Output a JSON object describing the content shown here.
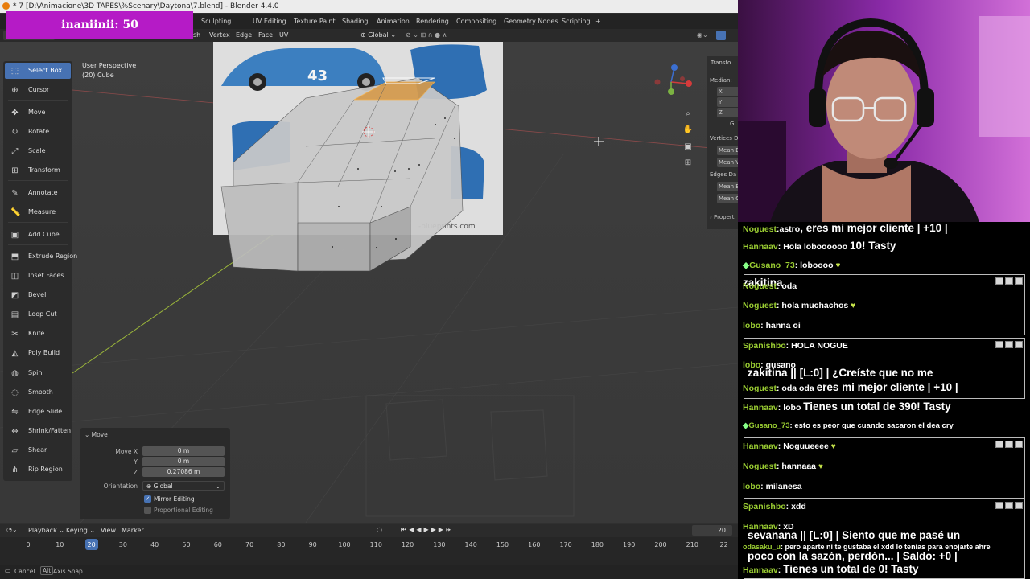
{
  "banner": {
    "text": "inaniinii: 50"
  },
  "window": {
    "title": "* 7 [D:\\Animacione\\3D TAPES\\%Scenary\\Daytona\\7.blend] - Blender 4.4.0"
  },
  "workspaces": [
    "Sculpting",
    "UV Editing",
    "Texture Paint",
    "Shading",
    "Animation",
    "Rendering",
    "Compositing",
    "Geometry Nodes",
    "Scripting",
    "+"
  ],
  "view_header": {
    "menus_left": [
      "sh",
      "Vertex",
      "Edge",
      "Face",
      "UV"
    ],
    "orientation": "Global"
  },
  "viewport": {
    "perspective": "User Perspective",
    "object": "(20) Cube",
    "blueprint_text": "-blueprints.com",
    "car_number": "43"
  },
  "tools": [
    {
      "label": "Select Box",
      "icon": "select-box-icon",
      "active": true
    },
    {
      "label": "Cursor",
      "icon": "cursor-icon"
    },
    {
      "label": "Move",
      "icon": "move-icon"
    },
    {
      "label": "Rotate",
      "icon": "rotate-icon"
    },
    {
      "label": "Scale",
      "icon": "scale-icon"
    },
    {
      "label": "Transform",
      "icon": "transform-icon"
    },
    {
      "label": "Annotate",
      "icon": "annotate-icon"
    },
    {
      "label": "Measure",
      "icon": "measure-icon"
    },
    {
      "label": "Add Cube",
      "icon": "add-cube-icon"
    },
    {
      "label": "Extrude Region",
      "icon": "extrude-icon"
    },
    {
      "label": "Inset Faces",
      "icon": "inset-icon"
    },
    {
      "label": "Bevel",
      "icon": "bevel-icon"
    },
    {
      "label": "Loop Cut",
      "icon": "loop-cut-icon"
    },
    {
      "label": "Knife",
      "icon": "knife-icon"
    },
    {
      "label": "Poly Build",
      "icon": "poly-build-icon"
    },
    {
      "label": "Spin",
      "icon": "spin-icon"
    },
    {
      "label": "Smooth",
      "icon": "smooth-icon"
    },
    {
      "label": "Edge Slide",
      "icon": "edge-slide-icon"
    },
    {
      "label": "Shrink/Fatten",
      "icon": "shrink-icon"
    },
    {
      "label": "Shear",
      "icon": "shear-icon"
    },
    {
      "label": "Rip Region",
      "icon": "rip-icon"
    }
  ],
  "npanel": {
    "tab": "Transfo",
    "median": "Median:",
    "x": "X",
    "y": "Y",
    "z": "Z",
    "gl": "Gl",
    "vertices": "Vertices D",
    "mean_b": "Mean B",
    "mean_v": "Mean V",
    "edges": "Edges Da",
    "mean_b2": "Mean B",
    "mean_c": "Mean C",
    "props": "Propert"
  },
  "operator": {
    "title": "Move",
    "move_x_label": "Move X",
    "move_x": "0 m",
    "y_label": "Y",
    "y": "0 m",
    "z_label": "Z",
    "z": "0.27086 m",
    "orientation_label": "Orientation",
    "orientation": "Global",
    "mirror": "Mirror Editing",
    "proportional": "Proportional Editing"
  },
  "timeline": {
    "menus": [
      "Playback",
      "Keying",
      "View",
      "Marker"
    ],
    "current_frame": "20",
    "ticks": [
      "0",
      "10",
      "20",
      "30",
      "40",
      "50",
      "60",
      "70",
      "80",
      "90",
      "100",
      "110",
      "120",
      "130",
      "140",
      "150",
      "160",
      "170",
      "180",
      "190",
      "200",
      "210",
      "22"
    ]
  },
  "status": {
    "cancel": "Cancel",
    "alt": "Alt",
    "axis_snap": "Axis Snap"
  },
  "chat": {
    "l1_user": "Noguest",
    "l1_text": "astro",
    "l1_big": ", eres mi mejor cliente |   +10 |",
    "l2_user": "Hannaav",
    "l2_text": "Hola loboooooo",
    "l2_big": "10! Tasty",
    "l3_user": "Gusano_73",
    "l3_text": "loboooo",
    "l4_big": "zakitina",
    "l5_user": "Noguest",
    "l5_text": "oda",
    "l6_user": "Noguest",
    "l6_text": "hola muchachos",
    "l7_user": "lobo",
    "l7_text": "hanna oi",
    "l8_user": "Spanishbo",
    "l8_text": "HOLA NOGUE",
    "l9_user": "lobo",
    "l9_text": "gusano",
    "l9_big": "zakitina || [L:0] | ¿Creíste que no me",
    "l10_user": "Noguest",
    "l10_text": "oda oda",
    "l10_big": "eres mi mejor cliente |   +10 |",
    "l11_user": "Hannaav",
    "l11_text": "lobo",
    "l11_big": "Tienes un total de 390! Tasty",
    "l12_user": "Gusano_73",
    "l12_text": "esto es peor que cuando sacaron el dea cry",
    "l13_user": "Hannaav",
    "l13_text": "Noguueeee",
    "l14_user": "Noguest",
    "l14_text": "hannaaa",
    "l15_user": "lobo",
    "l15_text": "milanesa",
    "l16_user": "Spanishbo",
    "l16_text": "xdd",
    "l17_user": "Hannaav",
    "l17_text": "xD",
    "l17_big": "sevanana || [L:0] | Siento que me pasé un",
    "l18_user": "odasaku_u",
    "l18_text": "pero aparte ni te gustaba el xdd lo tenias para enojarte ahre",
    "l18_big": "poco con la sazón, perdón... | Saldo: +0 |",
    "l19_user": "Hannaav",
    "l19_big": "Tienes un total de 0! Tasty"
  },
  "colors": {
    "accent": "#4772b3",
    "banner": "#b51bc6",
    "blender_orange": "#e87d0d"
  }
}
